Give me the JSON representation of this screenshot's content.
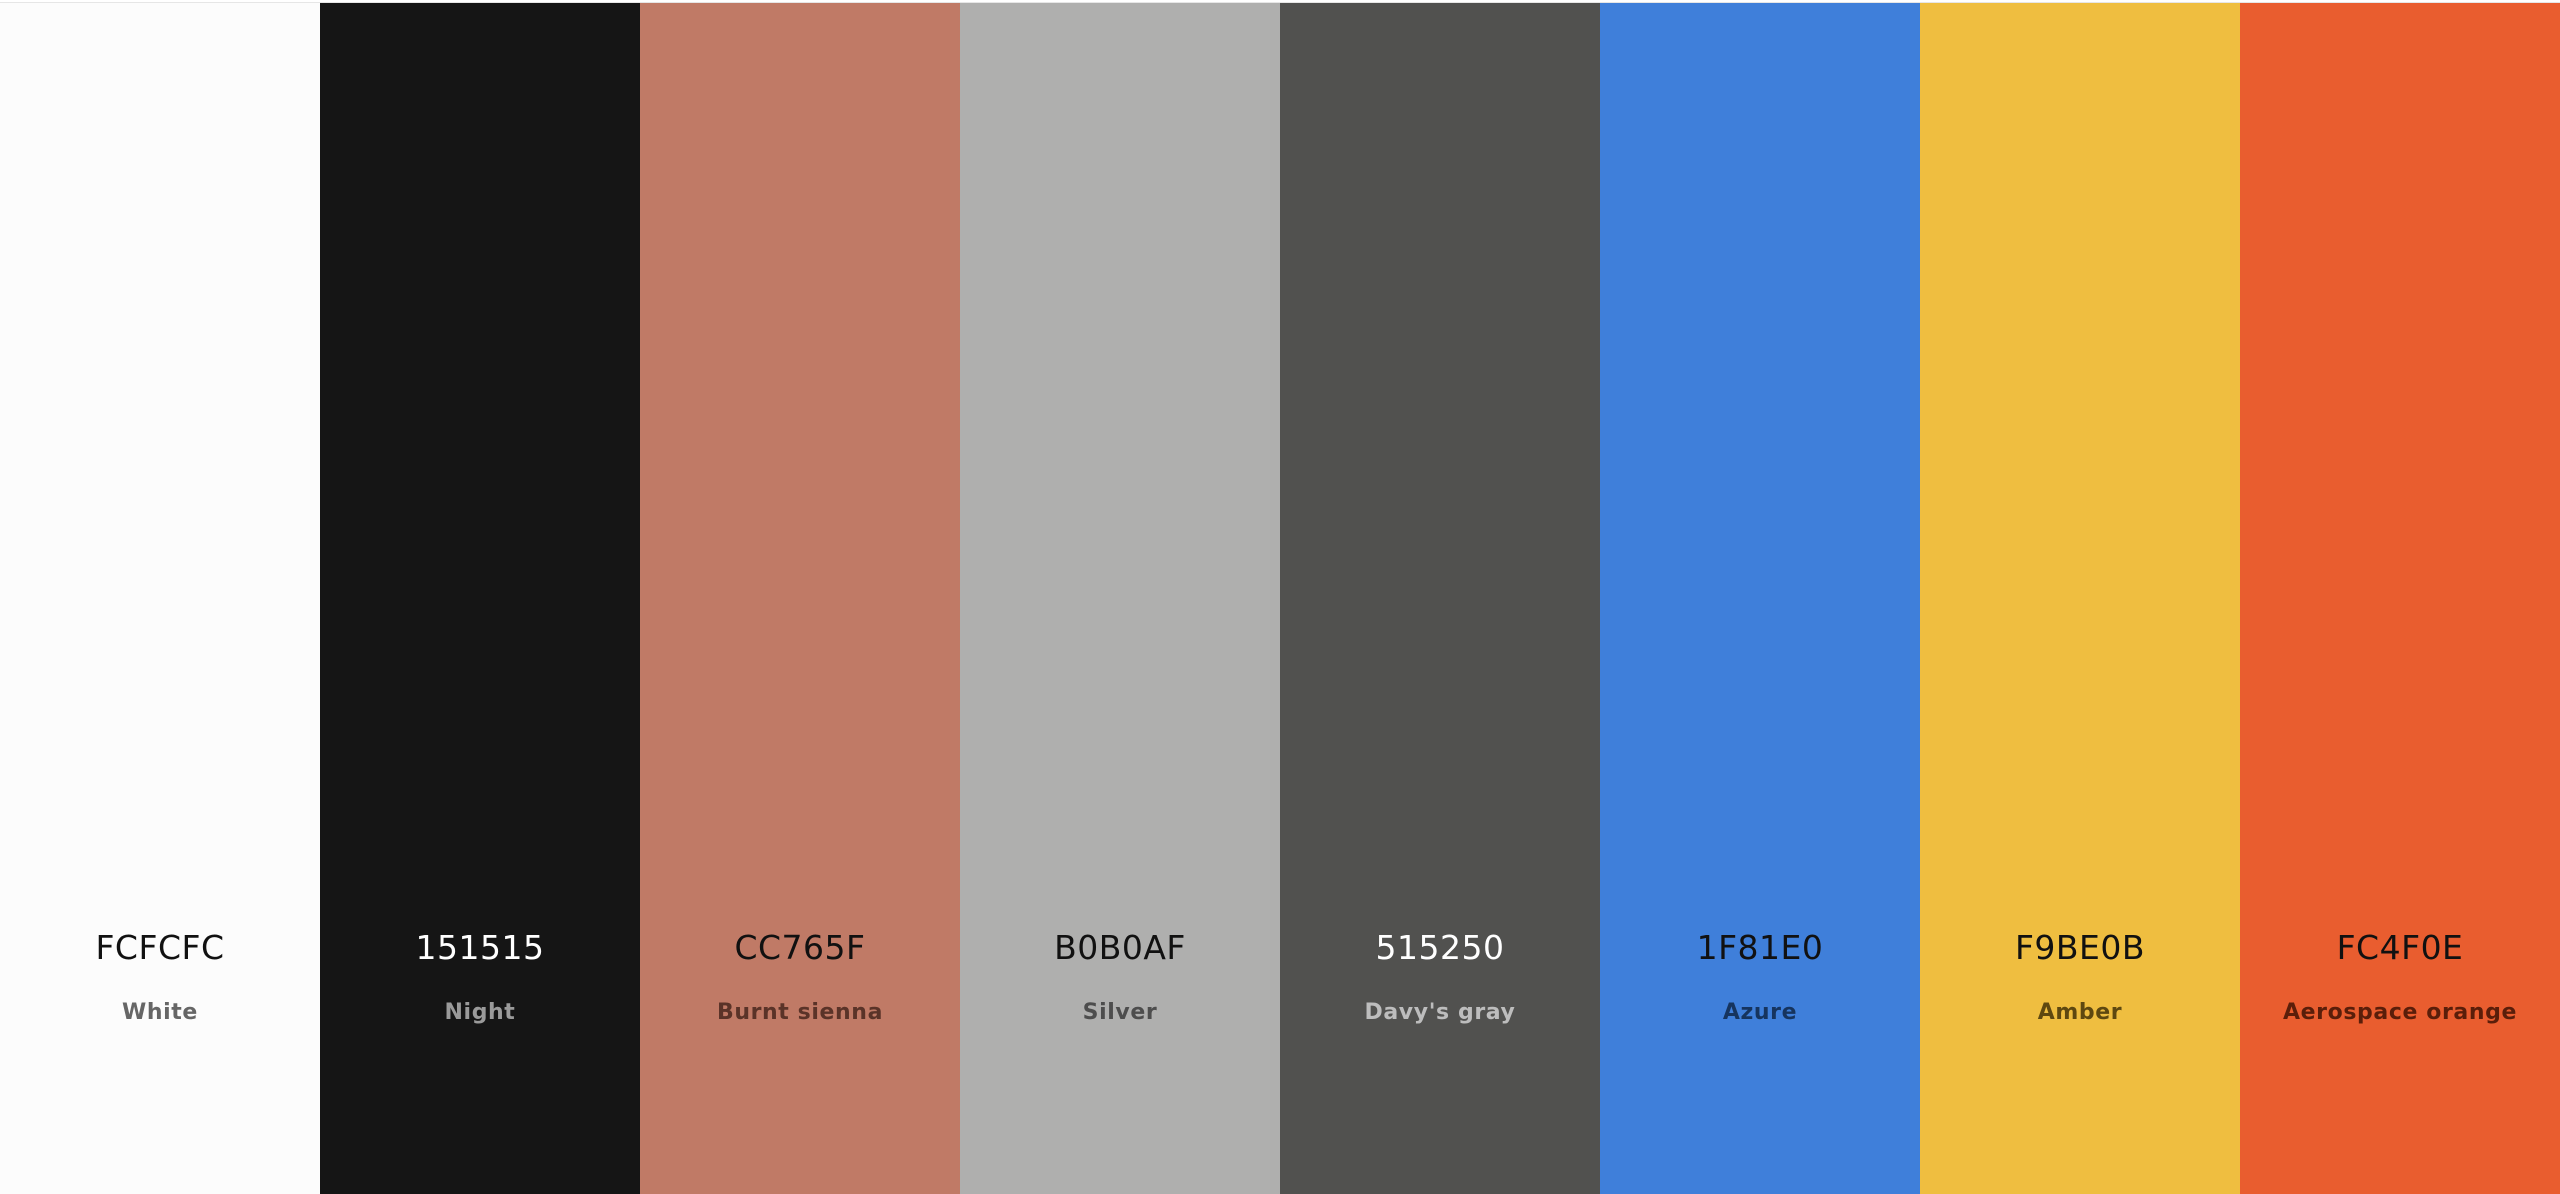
{
  "palette": {
    "swatches": [
      {
        "hex": "FCFCFC",
        "name": "White",
        "color": "#FCFCFC",
        "hex_text_color": "#111111",
        "name_text_color": "#666666"
      },
      {
        "hex": "151515",
        "name": "Night",
        "color": "#151515",
        "hex_text_color": "#FFFFFF",
        "name_text_color": "#9A9A9A"
      },
      {
        "hex": "CC765F",
        "name": "Burnt sienna",
        "color": "#C07A66",
        "hex_text_color": "#111111",
        "name_text_color": "#5A3328"
      },
      {
        "hex": "B0B0AF",
        "name": "Silver",
        "color": "#AFAFAE",
        "hex_text_color": "#111111",
        "name_text_color": "#4D4D4D"
      },
      {
        "hex": "515250",
        "name": "Davy's gray",
        "color": "#51514F",
        "hex_text_color": "#FFFFFF",
        "name_text_color": "#BDBDBD"
      },
      {
        "hex": "1F81E0",
        "name": "Azure",
        "color": "#3F7FDA",
        "hex_text_color": "#111111",
        "name_text_color": "#16345E"
      },
      {
        "hex": "F9BE0B",
        "name": "Amber",
        "color": "#EFBE40",
        "hex_text_color": "#111111",
        "name_text_color": "#5E4810"
      },
      {
        "hex": "FC4F0E",
        "name": "Aerospace orange",
        "color": "#E95D2F",
        "hex_text_color": "#111111",
        "name_text_color": "#5A1E0A"
      }
    ]
  }
}
